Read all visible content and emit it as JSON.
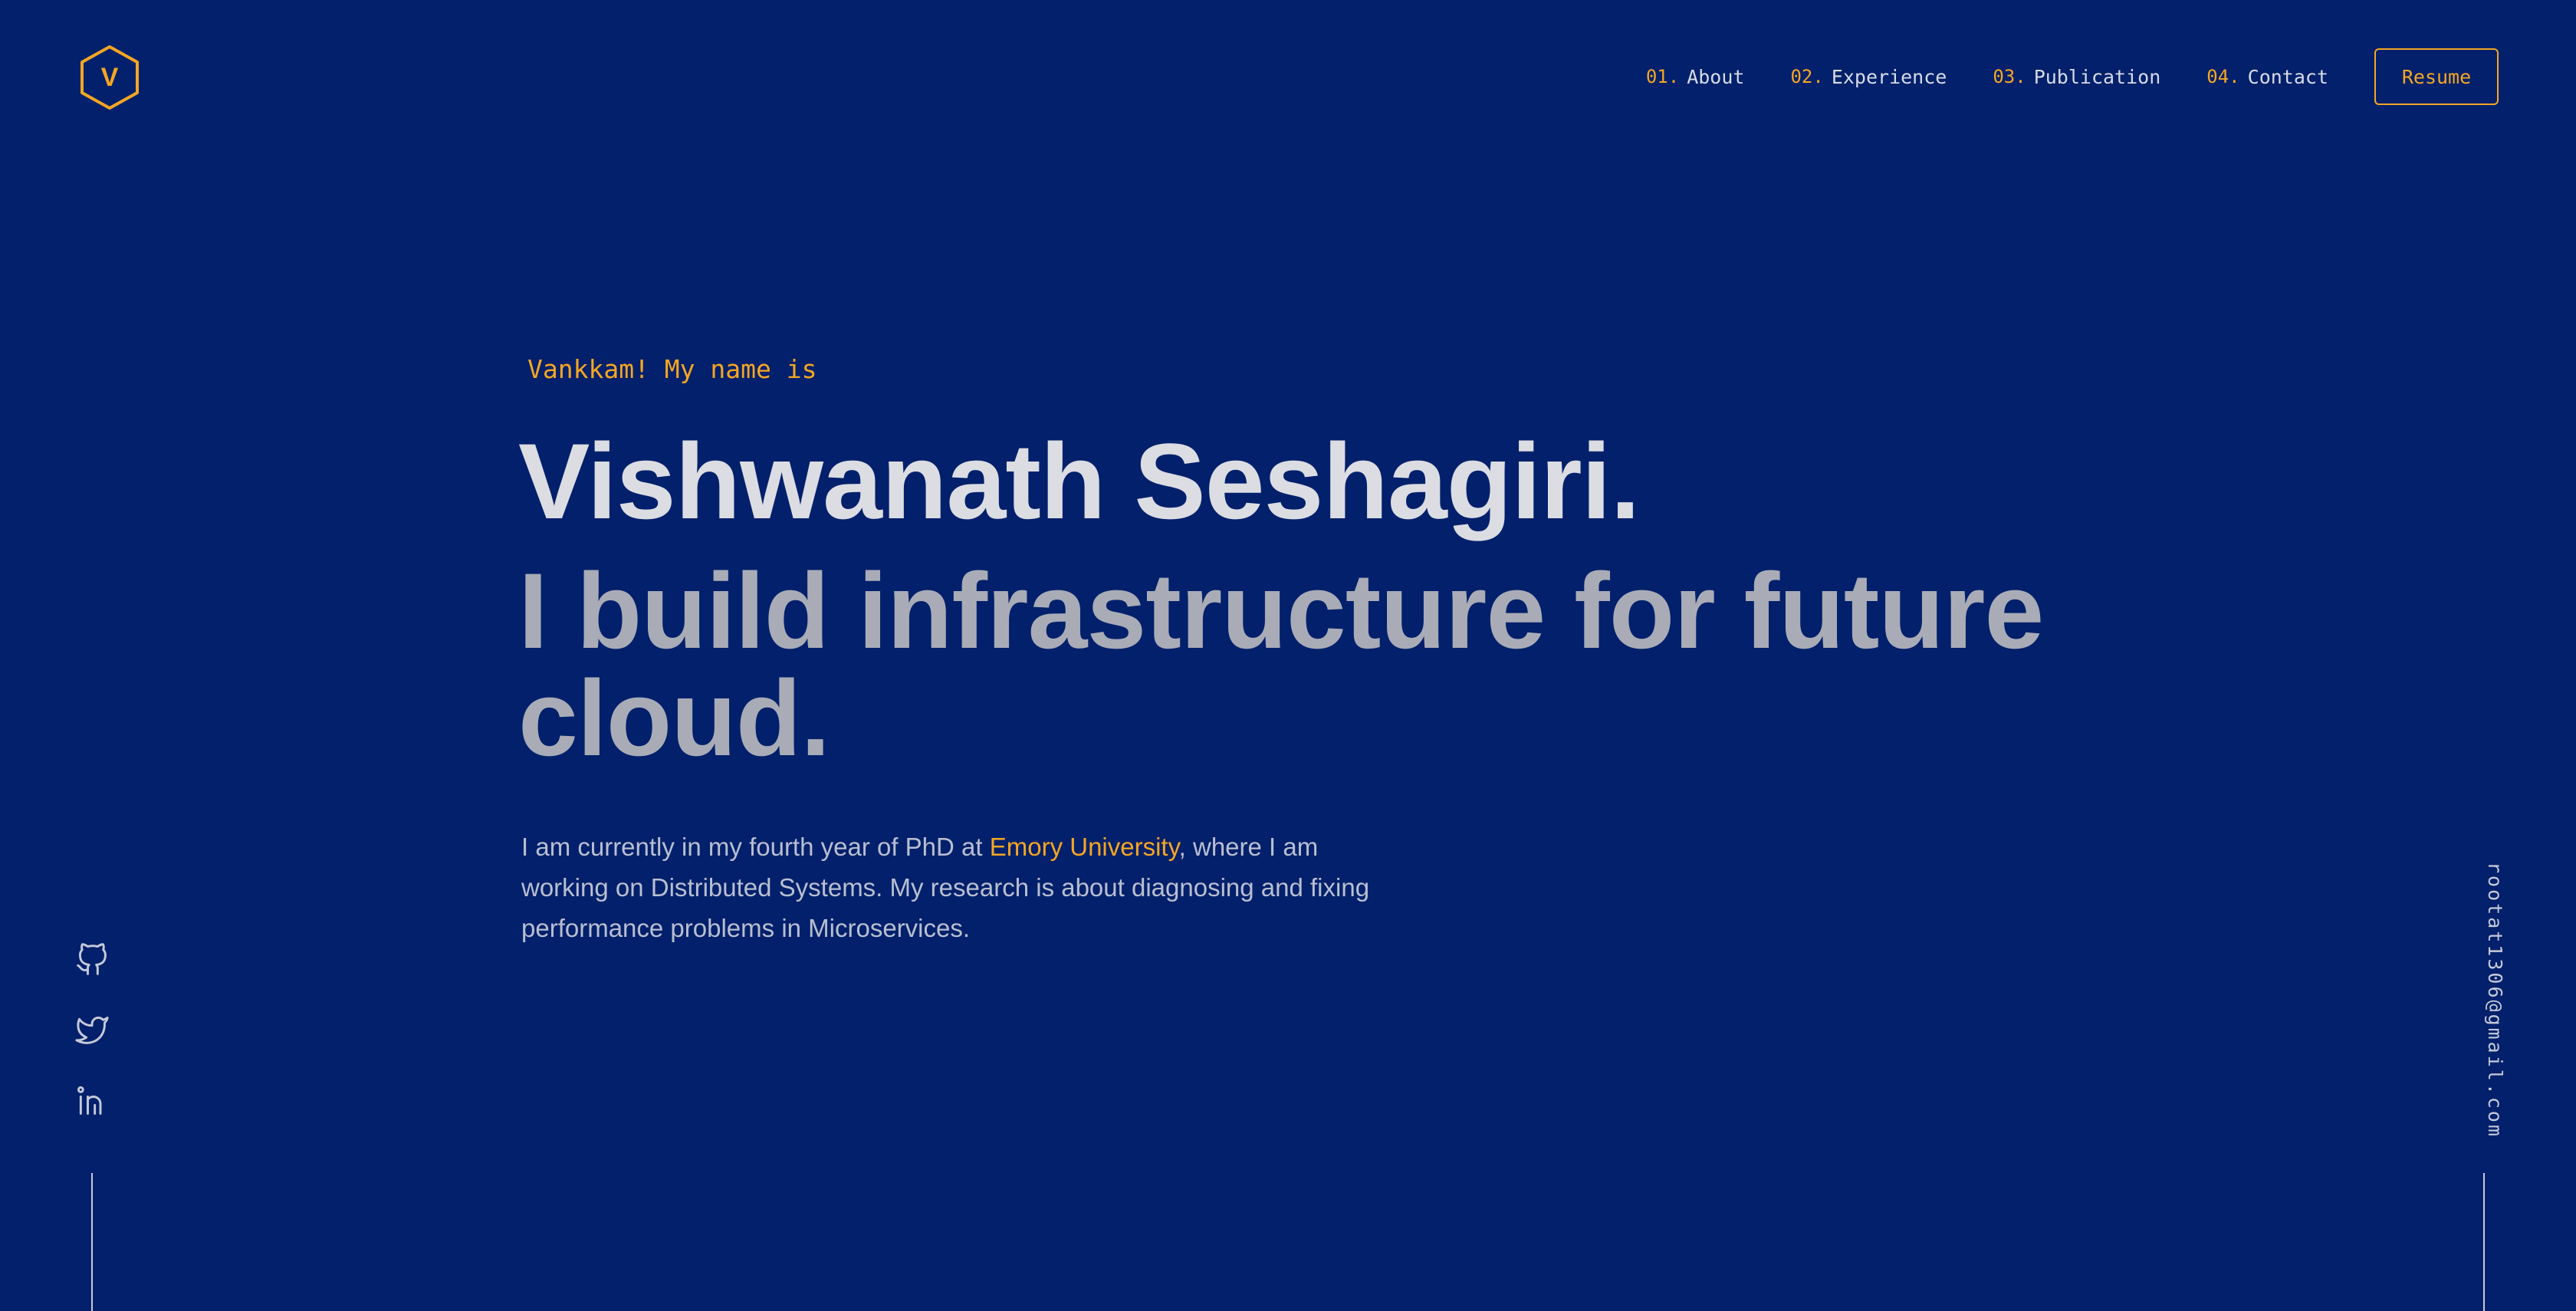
{
  "brand": {
    "logo_letter": "V",
    "accent_color": "#f5a623",
    "background_color": "#02206b"
  },
  "nav": {
    "items": [
      {
        "num": "01.",
        "label": "About"
      },
      {
        "num": "02.",
        "label": "Experience"
      },
      {
        "num": "03.",
        "label": "Publication"
      },
      {
        "num": "04.",
        "label": "Contact"
      }
    ],
    "resume_label": "Resume"
  },
  "hero": {
    "greeting": "Vankkam! My name is",
    "name": "Vishwanath Seshagiri.",
    "tagline": "I build infrastructure for future cloud.",
    "bio_before": "I am currently in my fourth year of PhD at ",
    "bio_link": "Emory University",
    "bio_after": ", where I am working on Distributed Systems. My research is about diagnosing and fixing performance problems in Microservices."
  },
  "social": {
    "icons": [
      "github-icon",
      "twitter-icon",
      "linkedin-icon"
    ]
  },
  "email": "rootat1306@gmail.com"
}
